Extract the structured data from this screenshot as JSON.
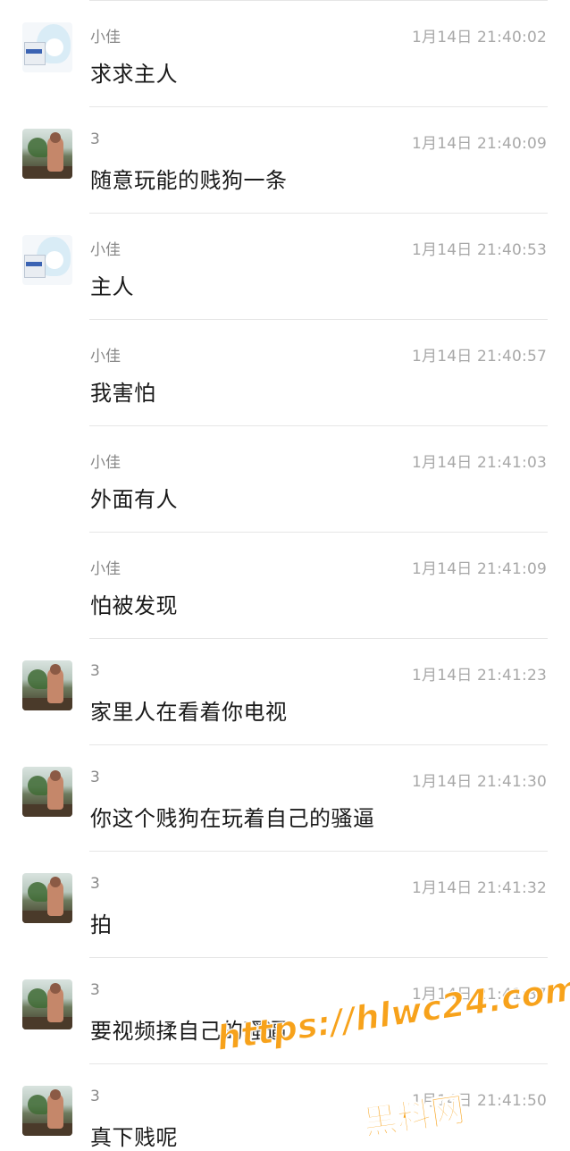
{
  "messages": [
    {
      "sender": "小佳",
      "time": "1月14日 21:40:02",
      "text": "求求主人",
      "avatar": "anime-avatar"
    },
    {
      "sender": "3",
      "time": "1月14日 21:40:09",
      "text": "随意玩能的贱狗一条",
      "avatar": "photo-avatar"
    },
    {
      "sender": "小佳",
      "time": "1月14日 21:40:53",
      "text": "主人",
      "avatar": "anime-avatar"
    },
    {
      "sender": "小佳",
      "time": "1月14日 21:40:57",
      "text": "我害怕",
      "avatar": ""
    },
    {
      "sender": "小佳",
      "time": "1月14日 21:41:03",
      "text": "外面有人",
      "avatar": ""
    },
    {
      "sender": "小佳",
      "time": "1月14日 21:41:09",
      "text": "怕被发现",
      "avatar": ""
    },
    {
      "sender": "3",
      "time": "1月14日 21:41:23",
      "text": "家里人在看着你电视",
      "avatar": "photo-avatar"
    },
    {
      "sender": "3",
      "time": "1月14日 21:41:30",
      "text": "你这个贱狗在玩着自己的骚逼",
      "avatar": "photo-avatar"
    },
    {
      "sender": "3",
      "time": "1月14日 21:41:32",
      "text": "拍",
      "avatar": "photo-avatar"
    },
    {
      "sender": "3",
      "time": "1月14日 21:41:37",
      "text": "要视频揉自己的骚逼",
      "avatar": "photo-avatar"
    },
    {
      "sender": "3",
      "time": "1月14日 21:41:50",
      "text": "真下贱呢",
      "avatar": "photo-avatar"
    }
  ],
  "watermark": {
    "url": "https://hlwc24.com",
    "name": "黑料网"
  },
  "colors": {
    "background": "#ffffff",
    "divider": "#e6e6e6",
    "sender_text": "#888888",
    "time_text": "#a8a8a8",
    "message_text": "#1a1a1a",
    "watermark": "#f7a21b"
  }
}
